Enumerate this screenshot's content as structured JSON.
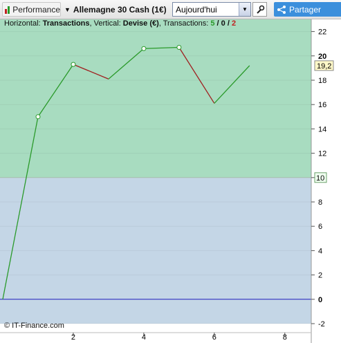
{
  "toolbar": {
    "performance_label": "Performance",
    "instrument_label": "Allemagne 30 Cash (1€)",
    "period_value": "Aujourd'hui",
    "share_label": "Partager",
    "accent_color": "#3b8fdc"
  },
  "header": {
    "horizontal_prefix": "Horizontal: ",
    "horizontal_value": "Transactions",
    "vertical_prefix": ", Vertical: ",
    "vertical_value": "Devise (€)",
    "transactions_prefix": ", Transactions: ",
    "wins": "5",
    "sep1": " / ",
    "neutral": "0",
    "sep2": " / ",
    "losses": "2"
  },
  "footer": {
    "copyright": "© IT-Finance.com"
  },
  "chart_data": {
    "type": "line",
    "x": [
      0,
      1,
      2,
      3,
      4,
      5,
      6,
      7
    ],
    "y": [
      0,
      15.0,
      19.3,
      18.1,
      20.6,
      20.7,
      16.1,
      19.2
    ],
    "xlim": [
      0,
      8.75
    ],
    "ylim": [
      -2,
      23
    ],
    "x_ticks": [
      2,
      4,
      6,
      8
    ],
    "y_ticks": [
      -2,
      0,
      2,
      4,
      6,
      8,
      10,
      12,
      14,
      16,
      18,
      20,
      22
    ],
    "last_value_label": "19,2",
    "threshold_label": "10",
    "threshold_value": 10,
    "colors": {
      "up": "#2a9a2a",
      "down": "#a02020",
      "above_threshold": "#a8dcc0",
      "below_threshold": "#c4d6e6",
      "zero_line": "#2020c0",
      "marker": "#2a9a2a"
    }
  }
}
